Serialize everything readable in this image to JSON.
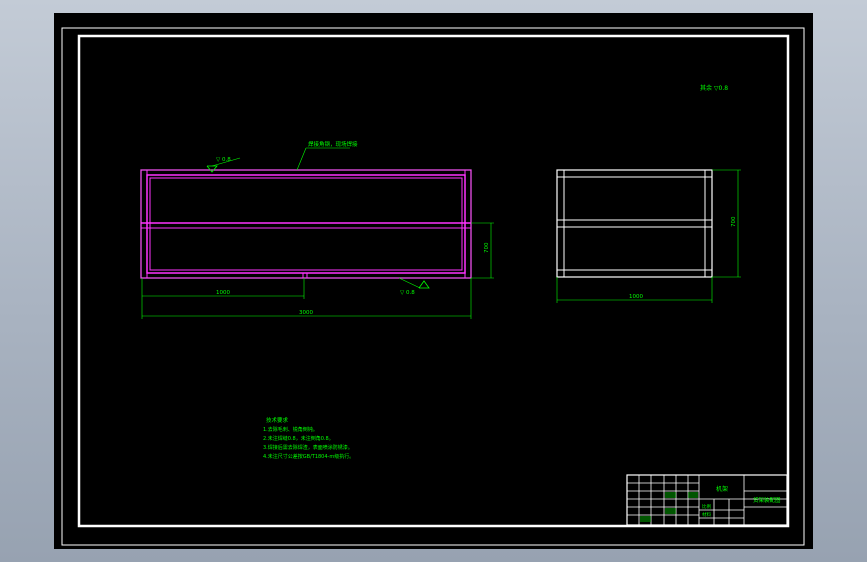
{
  "colors": {
    "background": "#000000",
    "frame": "#ffffff",
    "frame_magenta": "#ff33ff",
    "dimension": "#00ff00"
  },
  "front_view": {
    "weld_symbol_top": "▽ 0.8",
    "callout_top": "焊接角钢，现场焊接",
    "weld_symbol_bottom": "▽ 0.8",
    "dim_height": "700",
    "dim_partial": "1000",
    "dim_total": "3000"
  },
  "side_view": {
    "dim_height": "700",
    "dim_width": "1000"
  },
  "roughness_note": "其余 ▽0.8",
  "technical_requirements": {
    "title": "技术要求",
    "lines": [
      "1.去除毛刺、锐角倒钝。",
      "2.未注焊缝0.8，未注倒角0.8。",
      "3.焊接后需去除焊渣，表面喷涂防锈漆。",
      "4.未注尺寸公差按GB/T1804-m级执行。"
    ]
  },
  "title_block": {
    "part_name": "机架",
    "drawing_title": "货架装配图",
    "scale_label": "比例",
    "material_label": "材料"
  }
}
